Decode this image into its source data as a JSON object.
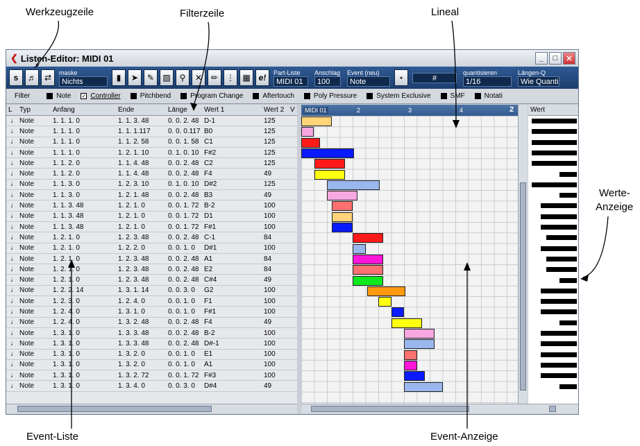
{
  "callouts": {
    "werkzeugzeile": "Werkzeugzeile",
    "filterzeile": "Filterzeile",
    "lineal": "Lineal",
    "werte_anzeige_1": "Werte-",
    "werte_anzeige_2": "Anzeige",
    "event_liste": "Event-Liste",
    "event_anzeige": "Event-Anzeige"
  },
  "window": {
    "title": "Listen-Editor: MIDI 01"
  },
  "toolbar": {
    "maske_label": "maske",
    "maske_value": "Nichts",
    "partliste_label": "Part-Liste",
    "partliste_value": "MIDI 01",
    "anschlag_label": "Anschlag",
    "anschlag_value": "100",
    "event_label": "Event (neu)",
    "event_value": "Note",
    "quant_label": "quantisieren",
    "quant_value": "1/16",
    "laengen_label": "Längen-Q",
    "laengen_value": "Wie Quantisie"
  },
  "filter": {
    "label": "Filter",
    "items": [
      "Note",
      "Controller",
      "Pitchbend",
      "Program Change",
      "Aftertouch",
      "Poly Pressure",
      "System Exclusive",
      "SMF",
      "Notati"
    ]
  },
  "columns": {
    "l": "L",
    "typ": "Typ",
    "anfang": "Anfang",
    "ende": "Ende",
    "laenge": "Länge",
    "wert1": "Wert 1",
    "wert2": "Wert 2",
    "v": "V",
    "wert": "Wert"
  },
  "ruler": {
    "part": "MIDI 01",
    "m2": "2",
    "m3": "3",
    "m4": "4",
    "m2b": "2"
  },
  "rows": [
    [
      "Note",
      "1. 1. 1.   0",
      "1. 1. 3. 48",
      "0. 0. 2. 48",
      "D-1",
      "125"
    ],
    [
      "Note",
      "1. 1. 1.   0",
      "1. 1. 1.117",
      "0. 0. 0.117",
      "B0",
      "125"
    ],
    [
      "Note",
      "1. 1. 1.   0",
      "1. 1. 2. 58",
      "0. 0. 1. 58",
      "C1",
      "125"
    ],
    [
      "Note",
      "1. 1. 1.   0",
      "1. 2. 1. 10",
      "0. 1. 0. 10",
      "F#2",
      "125"
    ],
    [
      "Note",
      "1. 1. 2.   0",
      "1. 1. 4. 48",
      "0. 0. 2. 48",
      "C2",
      "125"
    ],
    [
      "Note",
      "1. 1. 2.   0",
      "1. 1. 4. 48",
      "0. 0. 2. 48",
      "F4",
      "49"
    ],
    [
      "Note",
      "1. 1. 3.   0",
      "1. 2. 3. 10",
      "0. 1. 0. 10",
      "D#2",
      "125"
    ],
    [
      "Note",
      "1. 1. 3.   0",
      "1. 2. 1. 48",
      "0. 0. 2. 48",
      "B3",
      "49"
    ],
    [
      "Note",
      "1. 1. 3. 48",
      "1. 2. 1.   0",
      "0. 0. 1. 72",
      "B-2",
      "100"
    ],
    [
      "Note",
      "1. 1. 3. 48",
      "1. 2. 1.   0",
      "0. 0. 1. 72",
      "D1",
      "100"
    ],
    [
      "Note",
      "1. 1. 3. 48",
      "1. 2. 1.   0",
      "0. 0. 1. 72",
      "F#1",
      "100"
    ],
    [
      "Note",
      "1. 2. 1.   0",
      "1. 2. 3. 48",
      "0. 0. 2. 48",
      "C-1",
      "84"
    ],
    [
      "Note",
      "1. 2. 1.   0",
      "1. 2. 2.   0",
      "0. 0. 1.   0",
      "D#1",
      "100"
    ],
    [
      "Note",
      "1. 2. 1.   0",
      "1. 2. 3. 48",
      "0. 0. 2. 48",
      "A1",
      "84"
    ],
    [
      "Note",
      "1. 2. 1.   0",
      "1. 2. 3. 48",
      "0. 0. 2. 48",
      "E2",
      "84"
    ],
    [
      "Note",
      "1. 2. 1.   0",
      "1. 2. 3. 48",
      "0. 0. 2. 48",
      "C#4",
      "49"
    ],
    [
      "Note",
      "1. 2. 2. 14",
      "1. 3. 1. 14",
      "0. 0. 3.   0",
      "G2",
      "100"
    ],
    [
      "Note",
      "1. 2. 3.   0",
      "1. 2. 4.   0",
      "0. 0. 1.   0",
      "F1",
      "100"
    ],
    [
      "Note",
      "1. 2. 4.   0",
      "1. 3. 1.   0",
      "0. 0. 1.   0",
      "F#1",
      "100"
    ],
    [
      "Note",
      "1. 2. 4.   0",
      "1. 3. 2. 48",
      "0. 0. 2. 48",
      "F4",
      "49"
    ],
    [
      "Note",
      "1. 3. 1.   0",
      "1. 3. 3. 48",
      "0. 0. 2. 48",
      "B-2",
      "100"
    ],
    [
      "Note",
      "1. 3. 1.   0",
      "1. 3. 3. 48",
      "0. 0. 2. 48",
      "D#-1",
      "100"
    ],
    [
      "Note",
      "1. 3. 1.   0",
      "1. 3. 2.   0",
      "0. 0. 1.   0",
      "E1",
      "100"
    ],
    [
      "Note",
      "1. 3. 1.   0",
      "1. 3. 2.   0",
      "0. 0. 1.   0",
      "A1",
      "100"
    ],
    [
      "Note",
      "1. 3. 1.   0",
      "1. 3. 2. 72",
      "0. 0. 1. 72",
      "F#3",
      "100"
    ],
    [
      "Note",
      "1. 3. 1.   0",
      "1. 3. 4.   0",
      "0. 0. 3.   0",
      "D#4",
      "49"
    ]
  ],
  "event_colors": [
    "#ffd47a",
    "#f7a8e0",
    "#ff1a1a",
    "#0a1aff",
    "#ff1a1a",
    "#ffff10",
    "#9ab7ee",
    "#f7a8e0",
    "#ff7070",
    "#ffd47a",
    "#0a1aff",
    "#ff1a1a",
    "#9ab7ee",
    "#ff16d8",
    "#ff7070",
    "#10e81e",
    "#ff9a10",
    "#ffff10",
    "#0a1aff",
    "#ffff10",
    "#f7a8e0",
    "#9ab7ee",
    "#ff7070",
    "#ff16d8",
    "#0a1aff",
    "#9ab7ee"
  ]
}
